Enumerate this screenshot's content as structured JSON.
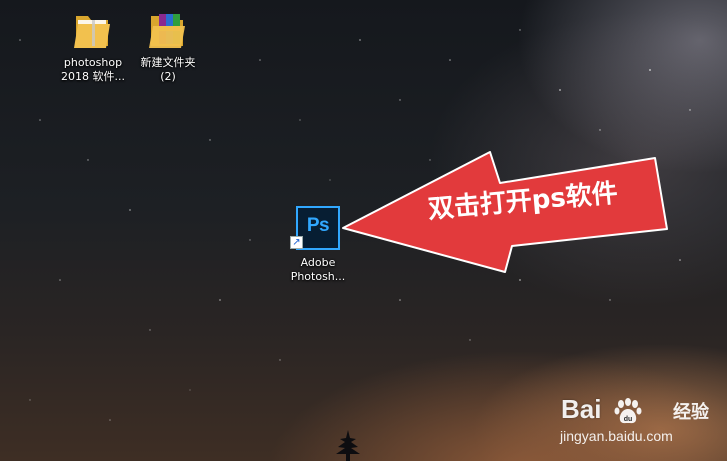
{
  "desktop": {
    "icons": [
      {
        "label": "photoshop\n2018 软件...",
        "icon": "folder-icon"
      },
      {
        "label": "新建文件夹\n(2)",
        "icon": "winrar-archive-icon"
      },
      {
        "label": "Adobe\nPhotosh...",
        "icon": "photoshop-icon",
        "tile_text": "Ps",
        "shortcut": true
      }
    ]
  },
  "callout": {
    "text": "双击打开ps软件",
    "color": "#e23a3c"
  },
  "watermark": {
    "brand_left": "Bai",
    "brand_right": "经验",
    "url": "jingyan.baidu.com"
  },
  "colors": {
    "ps_blue": "#31a8ff",
    "ps_bg": "#071e33",
    "folder_yellow": "#f2c14e"
  }
}
